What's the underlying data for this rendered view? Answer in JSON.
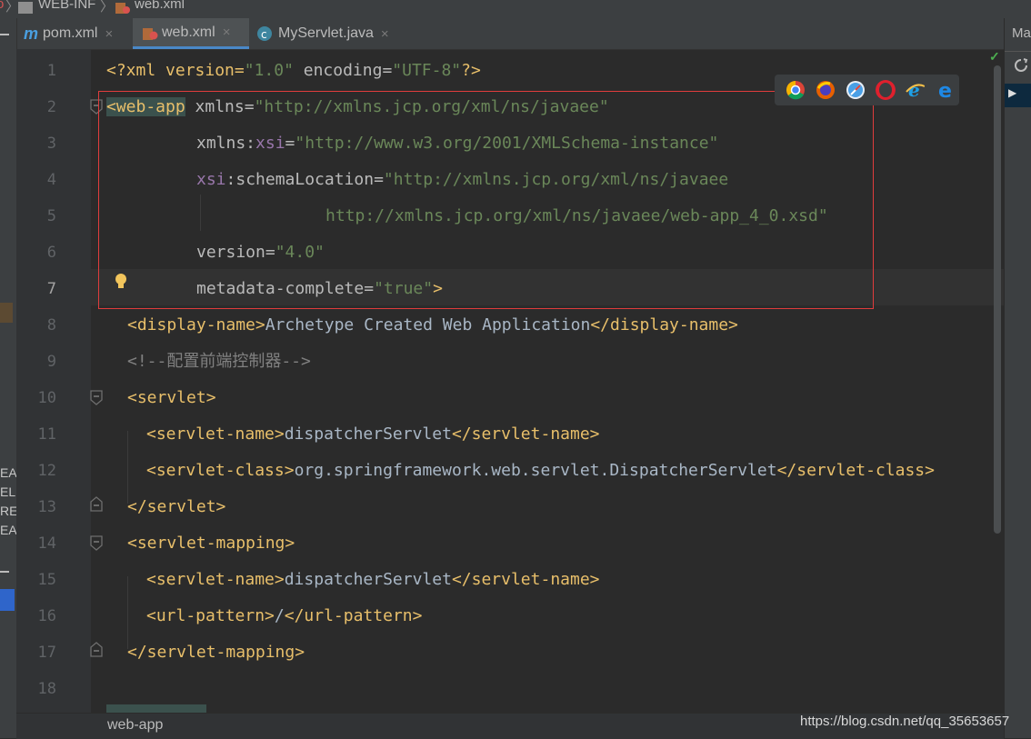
{
  "breadcrumb": {
    "folder": "WEB-INF",
    "file": "web.xml"
  },
  "tabs": [
    {
      "label": "pom.xml",
      "icon": "maven-m-icon"
    },
    {
      "label": "web.xml",
      "icon": "xml-file-icon",
      "active": true
    },
    {
      "label": "MyServlet.java",
      "icon": "java-class-icon"
    }
  ],
  "tab_close": "×",
  "right_panel": {
    "title": "Ma"
  },
  "left_strip": {
    "labels": [
      "EA",
      "EL",
      "RE",
      "EA"
    ]
  },
  "line_numbers": [
    "1",
    "2",
    "3",
    "4",
    "5",
    "6",
    "7",
    "8",
    "9",
    "10",
    "11",
    "12",
    "13",
    "14",
    "15",
    "16",
    "17",
    "18"
  ],
  "code": {
    "l1": [
      "<?xml version=",
      "\"1.0\"",
      " encoding=",
      "\"UTF-8\"",
      "?>"
    ],
    "l2": [
      "<web-app",
      " xmlns=",
      "\"http://xmlns.jcp.org/xml/ns/javaee\""
    ],
    "l3": [
      "xmlns:",
      "xsi",
      "=",
      "\"http://www.w3.org/2001/XMLSchema-instance\""
    ],
    "l4": [
      "xsi",
      ":schemaLocation=",
      "\"http://xmlns.jcp.org/xml/ns/javaee"
    ],
    "l5": [
      "http://xmlns.jcp.org/xml/ns/javaee/web-app_4_0.xsd\""
    ],
    "l6": [
      "version=",
      "\"4.0\""
    ],
    "l7": [
      "metadata-complete=",
      "\"true\"",
      ">"
    ],
    "l8": [
      "<display-name>",
      "Archetype Created Web Application",
      "</display-name>"
    ],
    "l9": [
      "<!--配置前端控制器-->"
    ],
    "l10": [
      "<servlet>"
    ],
    "l11": [
      "<servlet-name>",
      "dispatcherServlet",
      "</servlet-name>"
    ],
    "l12": [
      "<servlet-class>",
      "org.springframework.web.servlet.DispatcherServlet",
      "</servlet-class>"
    ],
    "l13": [
      "</servlet>"
    ],
    "l14": [
      "<servlet-mapping>"
    ],
    "l15": [
      "<servlet-name>",
      "dispatcherServlet",
      "</servlet-name>"
    ],
    "l16": [
      "<url-pattern>",
      "/",
      "</url-pattern>"
    ],
    "l17": [
      "</servlet-mapping>"
    ]
  },
  "status": {
    "path": "web-app",
    "watermark": "https://blog.csdn.net/qq_35653657"
  },
  "browsers": [
    "chrome-icon",
    "firefox-icon",
    "safari-icon",
    "opera-icon",
    "internet-explorer-icon",
    "edge-icon"
  ],
  "colors": {
    "tag": "#e8bf6a",
    "attr": "#bababa",
    "value": "#6a8759",
    "namespace": "#9876aa",
    "comment": "#808080",
    "highlight_box": "#e03c3c"
  }
}
